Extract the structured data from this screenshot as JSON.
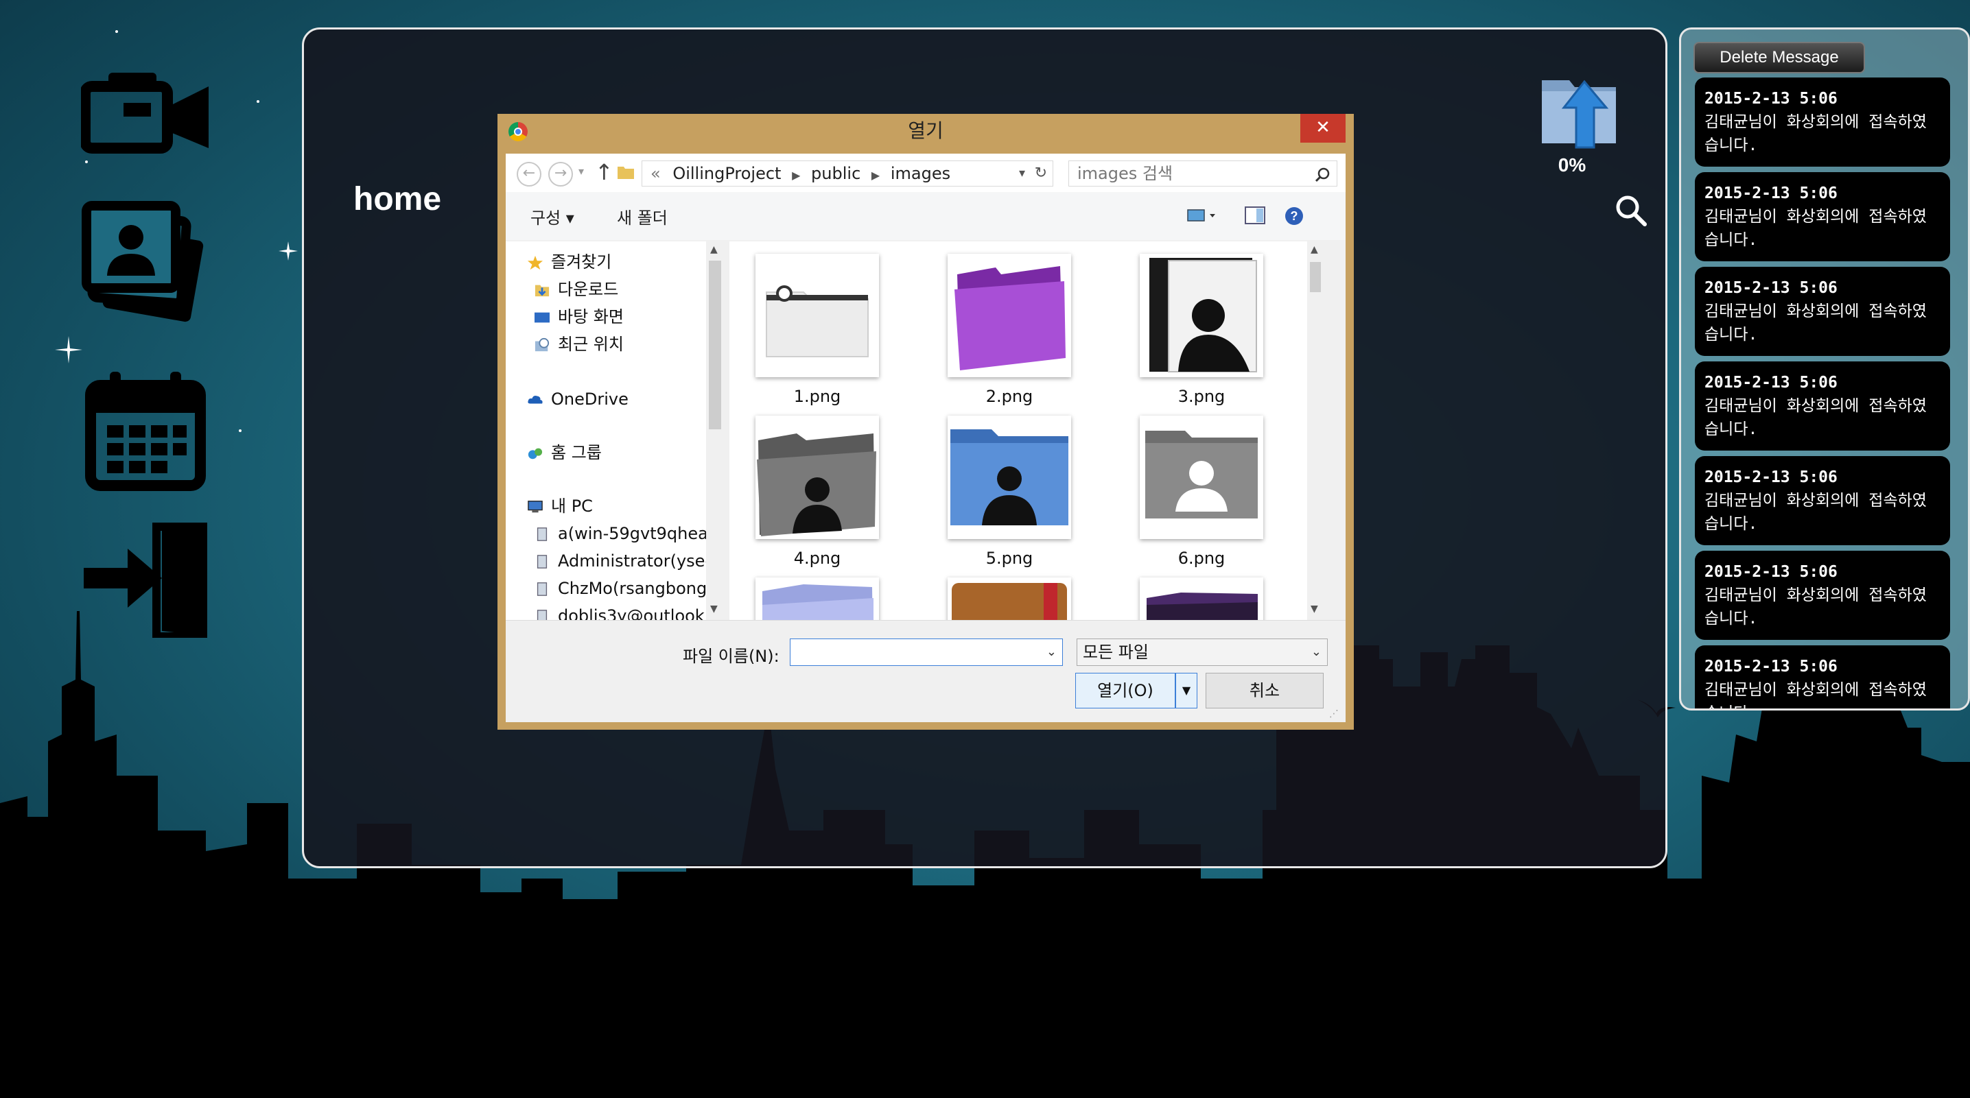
{
  "main": {
    "title": "home",
    "upload_progress": "0%"
  },
  "dialog": {
    "title": "열기",
    "close_label": "✕",
    "breadcrumb": {
      "prefix": "«",
      "parts": [
        "OillingProject",
        "public",
        "images"
      ]
    },
    "search_placeholder": "images 검색",
    "toolbar": {
      "organize": "구성 ▾",
      "new_folder": "새 폴더"
    },
    "tree": [
      {
        "label": "즐겨찾기",
        "icon": "star-icon"
      },
      {
        "label": "다운로드",
        "icon": "download-folder-icon"
      },
      {
        "label": "바탕 화면",
        "icon": "desktop-icon"
      },
      {
        "label": "최근 위치",
        "icon": "recent-places-icon"
      },
      {
        "label": "OneDrive",
        "icon": "onedrive-icon"
      },
      {
        "label": "홈 그룹",
        "icon": "homegroup-icon"
      },
      {
        "label": "내 PC",
        "icon": "pc-icon"
      },
      {
        "label": "a(win-59gvt9qhea",
        "icon": "user-folder-icon"
      },
      {
        "label": "Administrator(ysec",
        "icon": "user-folder-icon"
      },
      {
        "label": "ChzMo(rsangbong",
        "icon": "user-folder-icon"
      },
      {
        "label": "doblis3y@outlook",
        "icon": "user-folder-icon"
      }
    ],
    "files": [
      {
        "name": "1.png"
      },
      {
        "name": "2.png"
      },
      {
        "name": "3.png"
      },
      {
        "name": "4.png"
      },
      {
        "name": "5.png"
      },
      {
        "name": "6.png"
      }
    ],
    "filename_label": "파일 이름(N):",
    "filename_value": "",
    "filetype_value": "모든 파일",
    "open_label": "열기(O)",
    "cancel_label": "취소"
  },
  "messages": {
    "delete_label": "Delete Message",
    "items": [
      {
        "time": "2015-2-13 5:06",
        "text": "김태균님이 화상회의에 접속하였습니다."
      },
      {
        "time": "2015-2-13 5:06",
        "text": "김태균님이 화상회의에 접속하였습니다."
      },
      {
        "time": "2015-2-13 5:06",
        "text": "김태균님이 화상회의에 접속하였습니다."
      },
      {
        "time": "2015-2-13 5:06",
        "text": "김태균님이 화상회의에 접속하였습니다."
      },
      {
        "time": "2015-2-13 5:06",
        "text": "김태균님이 화상회의에 접속하였습니다."
      },
      {
        "time": "2015-2-13 5:06",
        "text": "김태균님이 화상회의에 접속하였습니다."
      },
      {
        "time": "2015-2-13 5:06",
        "text": "김태균님이 화상회의에 접속하였습니다."
      }
    ]
  },
  "nav": {
    "icons": [
      "video-camera-icon",
      "photos-icon",
      "calendar-icon",
      "exit-door-icon"
    ]
  },
  "colors": {
    "sky": "#1f6f84",
    "dialog_frame": "#c6a060",
    "close_red": "#c7392b",
    "message_bg": "#000000"
  }
}
